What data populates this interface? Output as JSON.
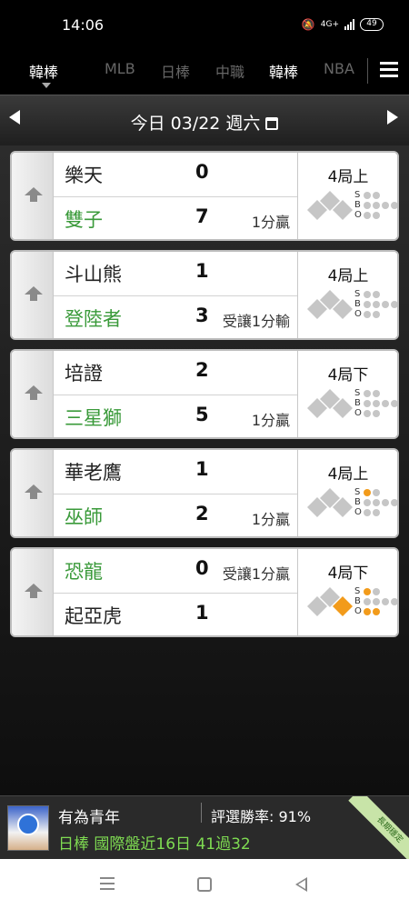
{
  "status": {
    "time": "14:06",
    "battery": "49",
    "network": "4G+"
  },
  "nav": {
    "current_league": "韓棒",
    "tabs": [
      "MLB",
      "日棒",
      "中職",
      "韓棒",
      "NBA"
    ],
    "active_tab": "韓棒"
  },
  "date_bar": {
    "label": "今日 03/22 週六"
  },
  "games": [
    {
      "away": {
        "name": "樂天",
        "score": "0",
        "note": "",
        "color": "#111111"
      },
      "home": {
        "name": "雙子",
        "score": "7",
        "note": "1分贏",
        "color": "#3a9a3a"
      },
      "inning": "4局上",
      "count": {
        "strikes": 0,
        "balls": 0,
        "outs": 0
      },
      "bases": {
        "first": false,
        "second": false,
        "third": false
      }
    },
    {
      "away": {
        "name": "斗山熊",
        "score": "1",
        "note": "",
        "color": "#111111"
      },
      "home": {
        "name": "登陸者",
        "score": "3",
        "note": "受讓1分輸",
        "color": "#3a9a3a"
      },
      "inning": "4局上",
      "count": {
        "strikes": 0,
        "balls": 0,
        "outs": 0
      },
      "bases": {
        "first": false,
        "second": false,
        "third": false
      }
    },
    {
      "away": {
        "name": "培證",
        "score": "2",
        "note": "",
        "color": "#111111"
      },
      "home": {
        "name": "三星獅",
        "score": "5",
        "note": "1分贏",
        "color": "#3a9a3a"
      },
      "inning": "4局下",
      "count": {
        "strikes": 0,
        "balls": 0,
        "outs": 0
      },
      "bases": {
        "first": false,
        "second": false,
        "third": false
      }
    },
    {
      "away": {
        "name": "華老鷹",
        "score": "1",
        "note": "",
        "color": "#111111"
      },
      "home": {
        "name": "巫師",
        "score": "2",
        "note": "1分贏",
        "color": "#3a9a3a"
      },
      "inning": "4局上",
      "count": {
        "strikes": 1,
        "balls": 0,
        "outs": 0
      },
      "bases": {
        "first": false,
        "second": false,
        "third": false
      }
    },
    {
      "away": {
        "name": "恐龍",
        "score": "0",
        "note": "受讓1分贏",
        "color": "#3a9a3a"
      },
      "home": {
        "name": "起亞虎",
        "score": "1",
        "note": "",
        "color": "#111111"
      },
      "inning": "4局下",
      "count": {
        "strikes": 1,
        "balls": 0,
        "outs": 2
      },
      "bases": {
        "first": true,
        "second": false,
        "third": false
      }
    }
  ],
  "footer": {
    "user_name": "有為青年",
    "win_rate": "評選勝率: 91%",
    "record": "日棒 國際盤近16日 41過32",
    "ribbon": "長期穩定"
  }
}
